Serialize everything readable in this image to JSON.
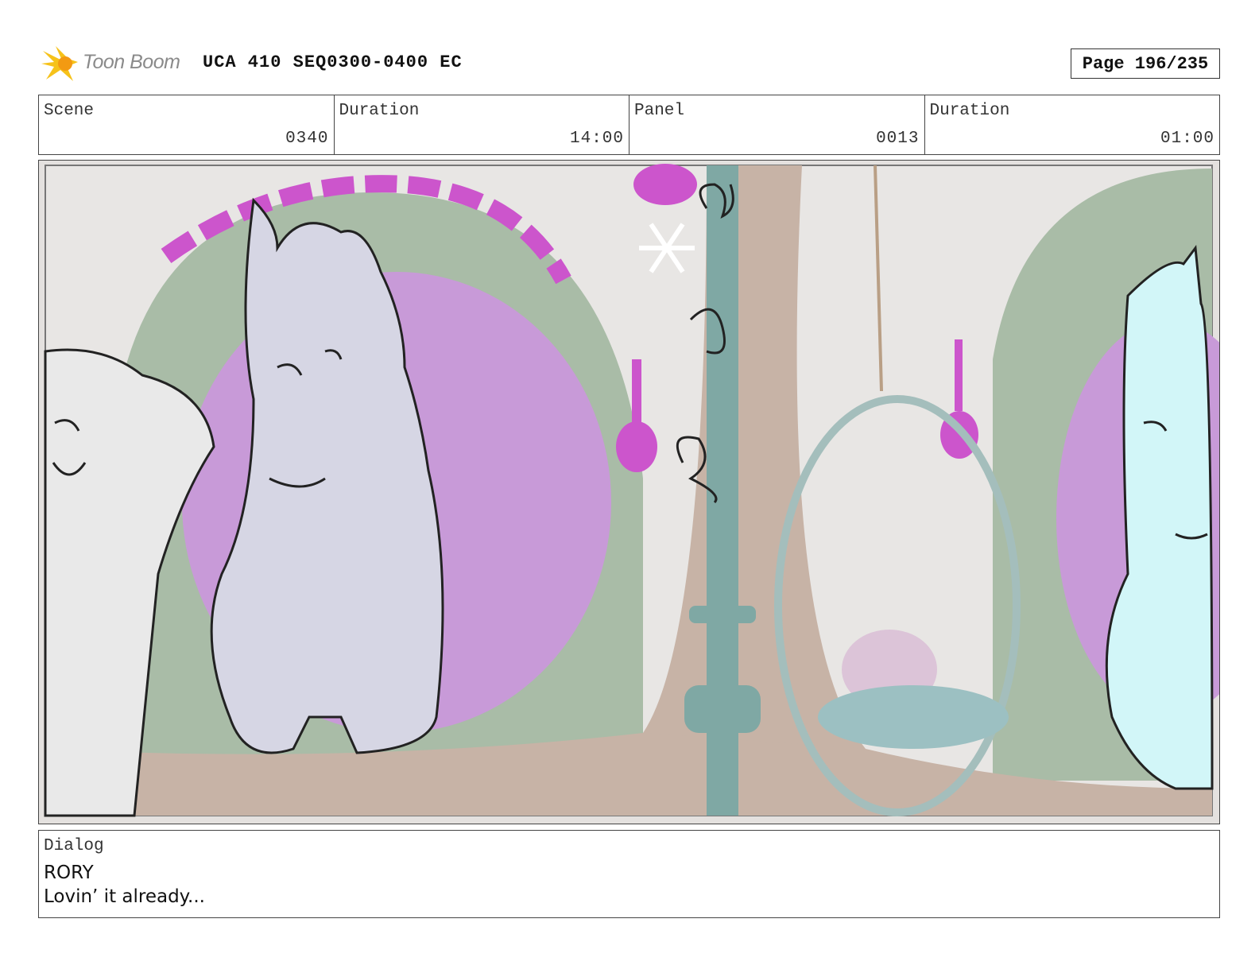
{
  "header": {
    "logo_text": "Toon Boom",
    "doc_title": "UCA 410 SEQ0300-0400 EC",
    "page_label": "Page 196/235"
  },
  "info": {
    "scene_label": "Scene",
    "scene_value": "0340",
    "scene_duration_label": "Duration",
    "scene_duration_value": "14:00",
    "panel_label": "Panel",
    "panel_value": "0013",
    "panel_duration_label": "Duration",
    "panel_duration_value": "01:00"
  },
  "dialog": {
    "label": "Dialog",
    "speaker": "RORY",
    "line": "Lovin’ it already..."
  },
  "colors": {
    "magenta_accent": "#cc55cc",
    "wall_green": "#a9bca7",
    "floor_brown": "#c7b3a6"
  }
}
